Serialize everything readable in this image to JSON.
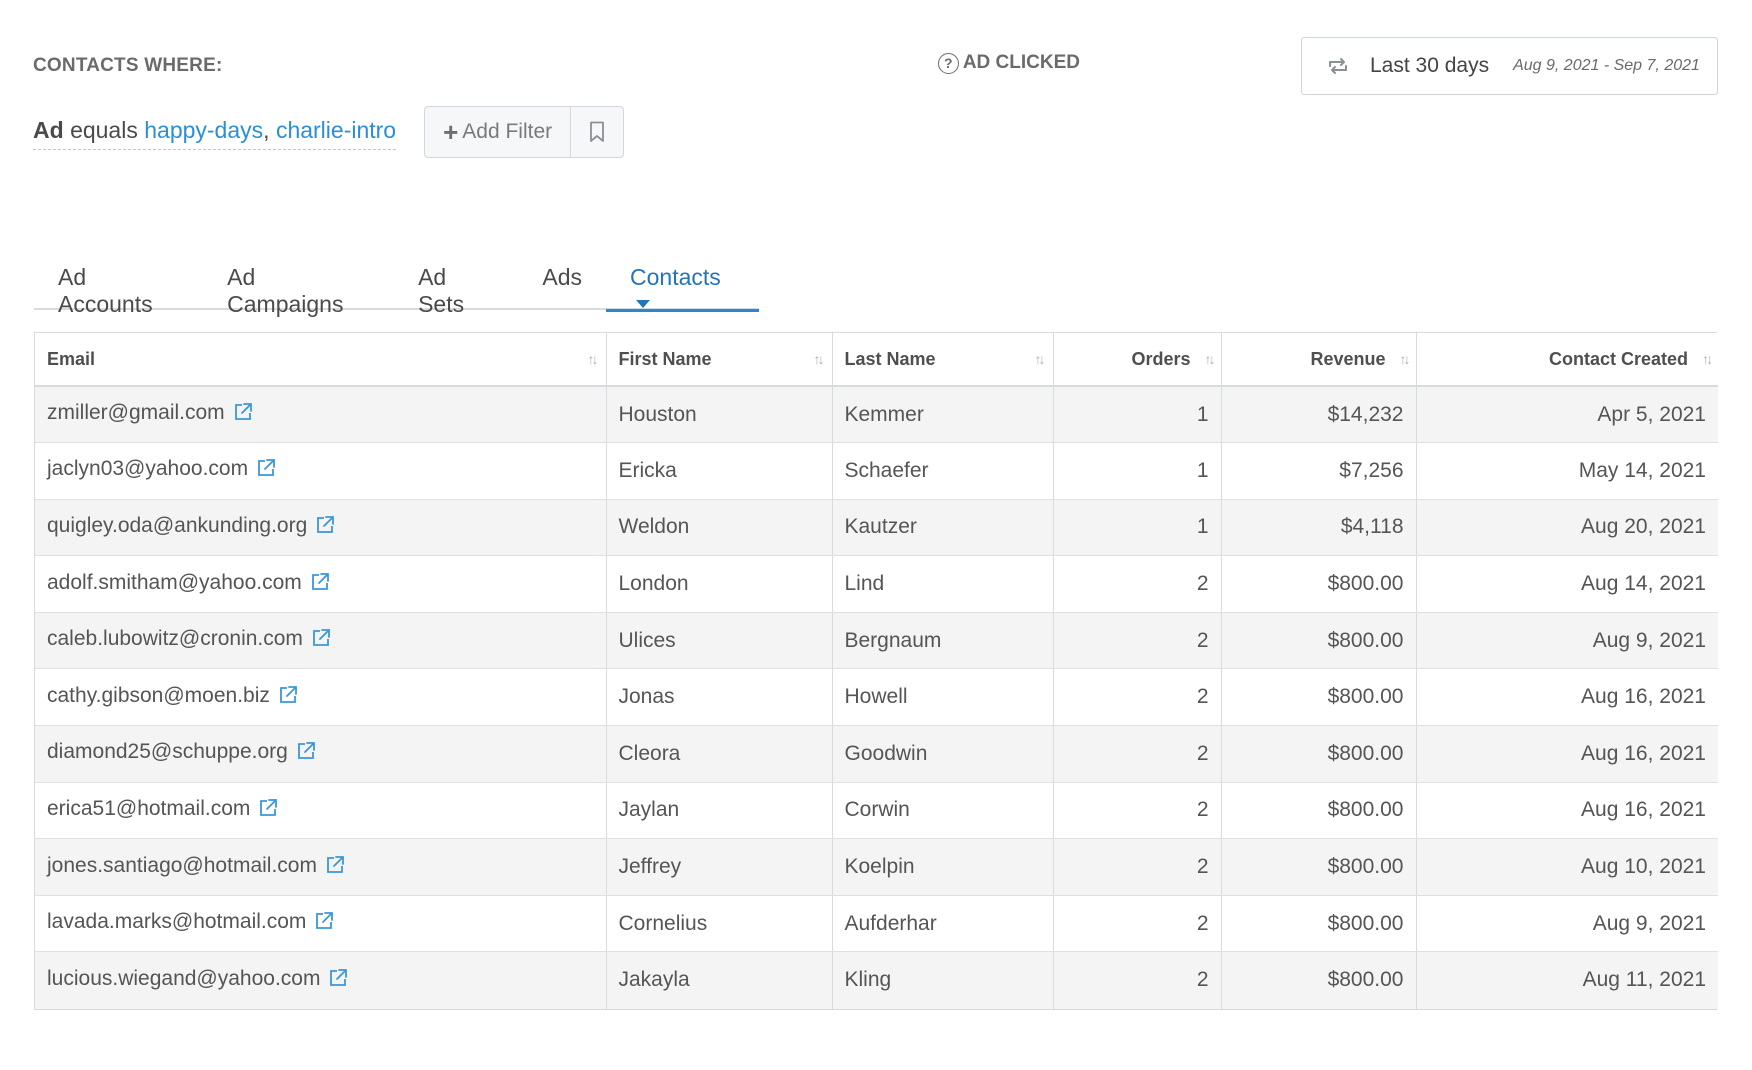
{
  "filter": {
    "heading": "CONTACTS WHERE:",
    "field": "Ad",
    "operator": "equals",
    "value1": "happy-days",
    "separator": ",",
    "value2": "charlie-intro",
    "add_filter_label": "Add Filter"
  },
  "attribution": {
    "label": "AD CLICKED",
    "help_glyph": "?"
  },
  "date_range": {
    "label": "Last 30 days",
    "dates": "Aug 9, 2021 - Sep 7, 2021"
  },
  "tabs": [
    {
      "label": "Ad Accounts"
    },
    {
      "label": "Ad Campaigns"
    },
    {
      "label": "Ad Sets"
    },
    {
      "label": "Ads"
    },
    {
      "label": "Contacts",
      "active": true
    }
  ],
  "table": {
    "columns": [
      "Email",
      "First Name",
      "Last Name",
      "Orders",
      "Revenue",
      "Contact Created"
    ],
    "rows": [
      {
        "email": "zmiller@gmail.com",
        "first": "Houston",
        "last": "Kemmer",
        "orders": "1",
        "revenue": "$14,232",
        "created": "Apr 5, 2021"
      },
      {
        "email": "jaclyn03@yahoo.com",
        "first": "Ericka",
        "last": "Schaefer",
        "orders": "1",
        "revenue": "$7,256",
        "created": "May 14, 2021"
      },
      {
        "email": "quigley.oda@ankunding.org",
        "first": "Weldon",
        "last": "Kautzer",
        "orders": "1",
        "revenue": "$4,118",
        "created": "Aug 20, 2021"
      },
      {
        "email": "adolf.smitham@yahoo.com",
        "first": "London",
        "last": "Lind",
        "orders": "2",
        "revenue": "$800.00",
        "created": "Aug 14, 2021"
      },
      {
        "email": "caleb.lubowitz@cronin.com",
        "first": "Ulices",
        "last": "Bergnaum",
        "orders": "2",
        "revenue": "$800.00",
        "created": "Aug 9, 2021"
      },
      {
        "email": "cathy.gibson@moen.biz",
        "first": "Jonas",
        "last": "Howell",
        "orders": "2",
        "revenue": "$800.00",
        "created": "Aug 16, 2021"
      },
      {
        "email": "diamond25@schuppe.org",
        "first": "Cleora",
        "last": "Goodwin",
        "orders": "2",
        "revenue": "$800.00",
        "created": "Aug 16, 2021"
      },
      {
        "email": "erica51@hotmail.com",
        "first": "Jaylan",
        "last": "Corwin",
        "orders": "2",
        "revenue": "$800.00",
        "created": "Aug 16, 2021"
      },
      {
        "email": "jones.santiago@hotmail.com",
        "first": "Jeffrey",
        "last": "Koelpin",
        "orders": "2",
        "revenue": "$800.00",
        "created": "Aug 10, 2021"
      },
      {
        "email": "lavada.marks@hotmail.com",
        "first": "Cornelius",
        "last": "Aufderhar",
        "orders": "2",
        "revenue": "$800.00",
        "created": "Aug 9, 2021"
      },
      {
        "email": "lucious.wiegand@yahoo.com",
        "first": "Jakayla",
        "last": "Kling",
        "orders": "2",
        "revenue": "$800.00",
        "created": "Aug 11, 2021"
      }
    ]
  },
  "icons": {
    "email_link": "external-link-icon",
    "sort": "sort-icon",
    "date_toggle": "repeat-icon",
    "bookmark": "bookmark-icon",
    "help": "help-circle-icon"
  },
  "colors": {
    "link": "#2b8fd6",
    "active_tab": "#2375bb",
    "stripe": "#f4f4f5",
    "border": "#d6dbe0"
  }
}
